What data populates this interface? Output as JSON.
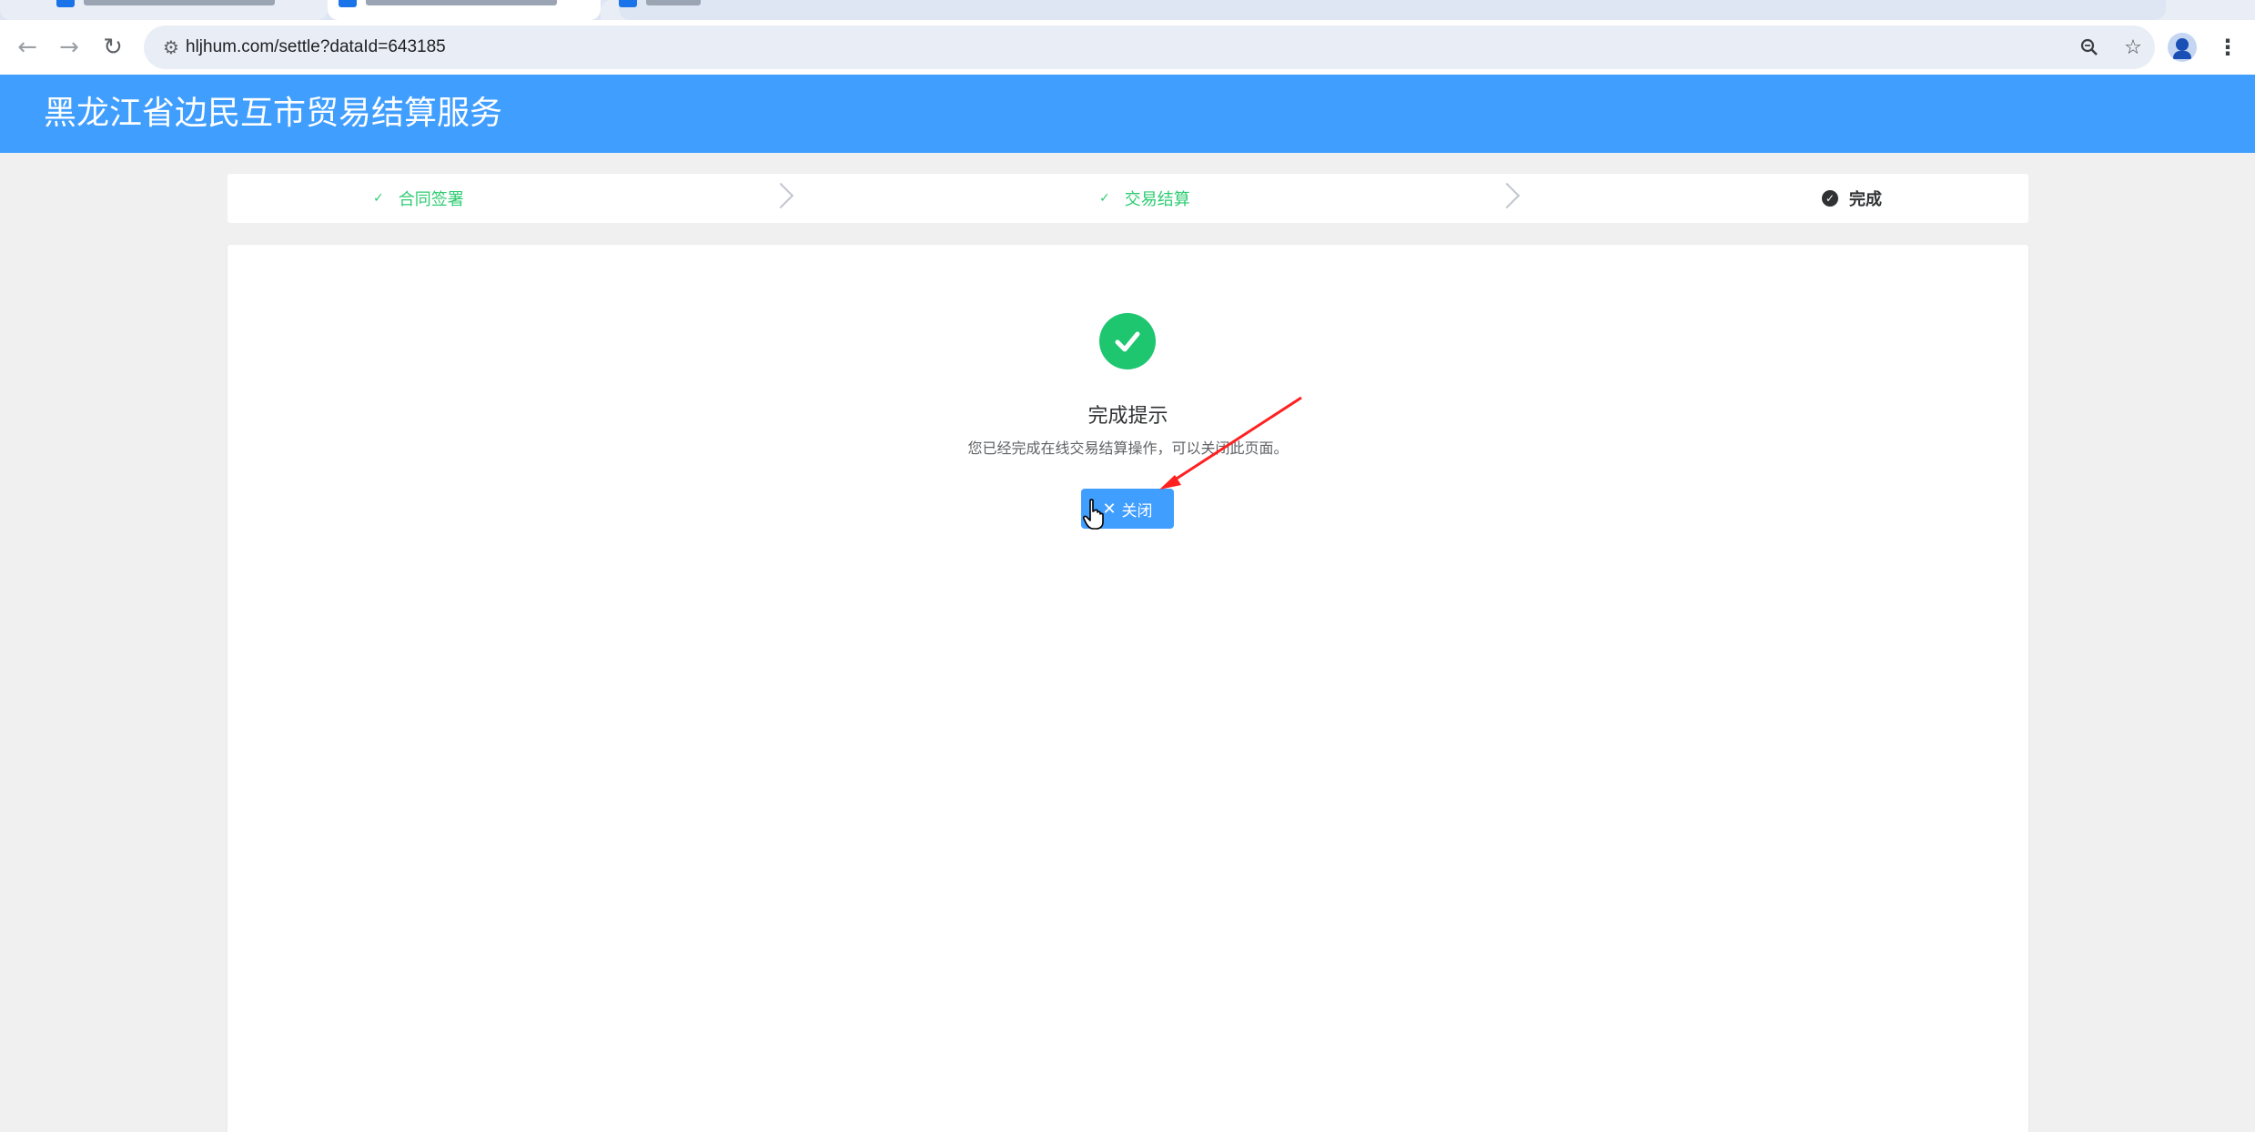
{
  "browser": {
    "url": "hljhum.com/settle?dataId=643185"
  },
  "header": {
    "title": "黑龙江省边民互市贸易结算服务",
    "background_color": "#409eff"
  },
  "steps": [
    {
      "label": "合同签署",
      "status": "done"
    },
    {
      "label": "交易结算",
      "status": "done"
    },
    {
      "label": "完成",
      "status": "current"
    }
  ],
  "result": {
    "title": "完成提示",
    "message": "您已经完成在线交易结算操作，可以关闭此页面。",
    "close_button": "关闭",
    "success_color": "#1ec66f"
  },
  "icons": {
    "back": "back-arrow-icon",
    "forward": "forward-arrow-icon",
    "reload": "reload-icon",
    "site_info": "site-info-icon",
    "zoom": "zoom-icon",
    "bookmark": "star-icon",
    "profile": "profile-icon",
    "menu": "more-menu-icon"
  }
}
